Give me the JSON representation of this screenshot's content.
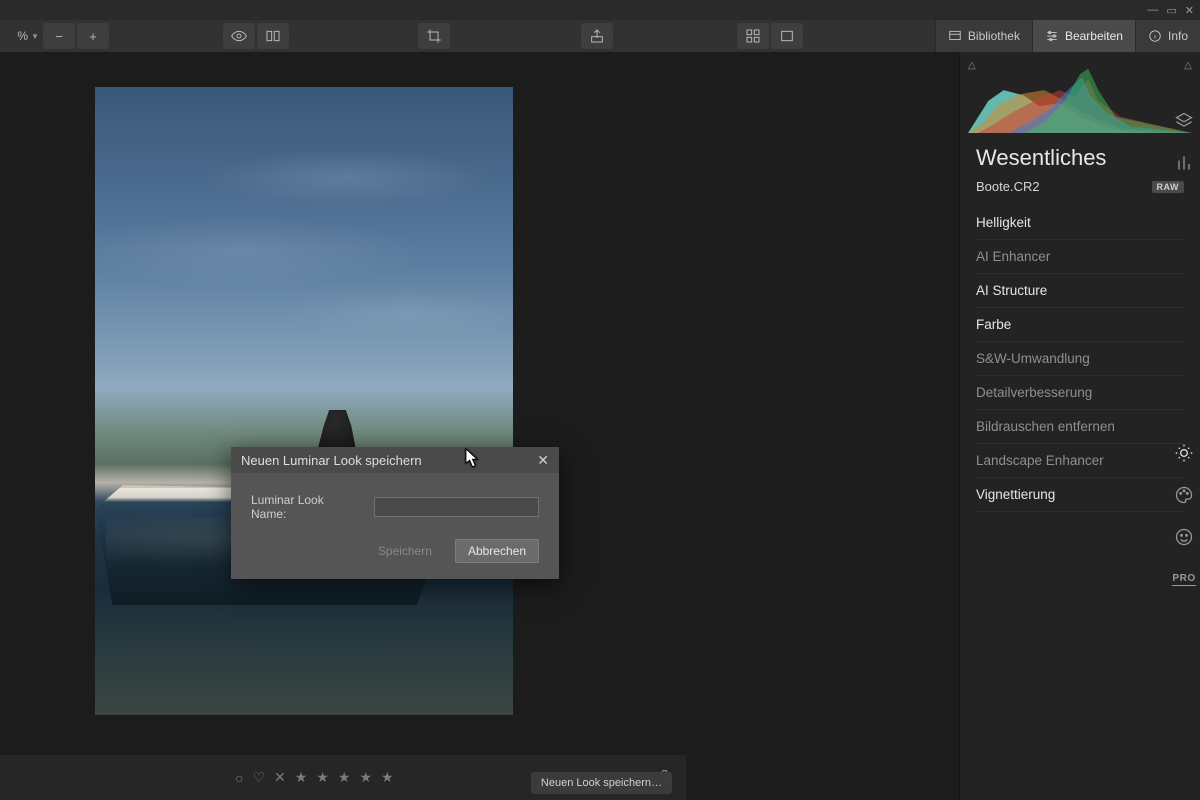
{
  "window": {
    "minimize": "—",
    "maximize": "▭",
    "close": "✕"
  },
  "toolbar": {
    "zoom_value": "%",
    "library_label": "Bibliothek",
    "edit_label": "Bearbeiten",
    "info_label": "Info"
  },
  "panel": {
    "title": "Wesentliches",
    "file_name": "Boote.CR2",
    "raw_badge": "RAW",
    "tools": [
      {
        "label": "Helligkeit",
        "bright": true
      },
      {
        "label": "AI Enhancer",
        "bright": false
      },
      {
        "label": "AI Structure",
        "bright": true
      },
      {
        "label": "Farbe",
        "bright": true
      },
      {
        "label": "S&W-Umwandlung",
        "bright": false
      },
      {
        "label": "Detailverbesserung",
        "bright": false
      },
      {
        "label": "Bildrauschen entfernen",
        "bright": false
      },
      {
        "label": "Landscape Enhancer",
        "bright": false
      },
      {
        "label": "Vignettierung",
        "bright": true
      }
    ]
  },
  "rail": {
    "pro": "PRO"
  },
  "rating": {
    "flag": "○",
    "heart": "♡",
    "reject": "✕",
    "stars": [
      "★",
      "★",
      "★",
      "★",
      "★"
    ]
  },
  "modal": {
    "title": "Neuen Luminar Look speichern",
    "field_label": "Luminar Look Name:",
    "input_value": "",
    "save": "Speichern",
    "cancel": "Abbrechen"
  },
  "status": {
    "text": "Neuen Look speichern…"
  }
}
